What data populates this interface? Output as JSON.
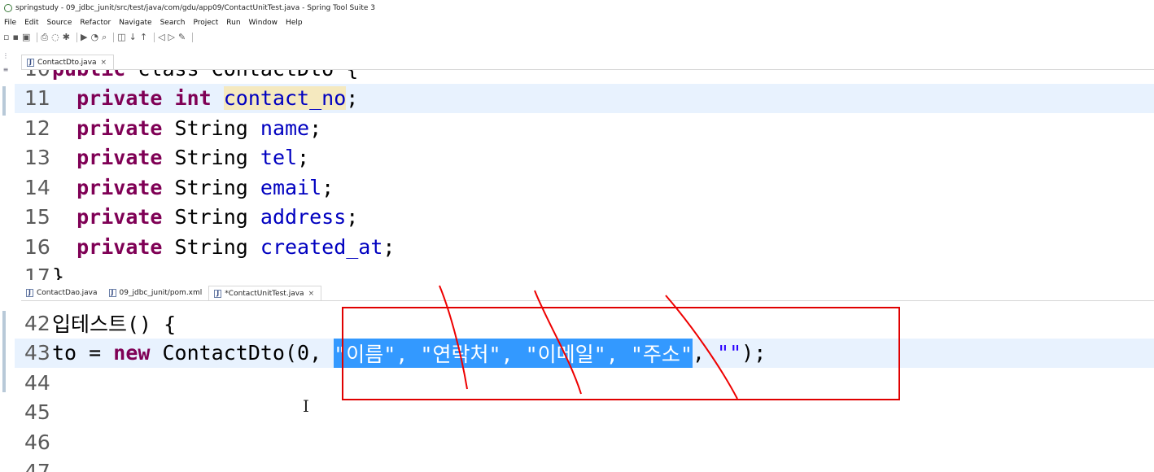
{
  "window": {
    "title": "springstudy - 09_jdbc_junit/src/test/java/com/gdu/app09/ContactUnitTest.java - Spring Tool Suite 3"
  },
  "menu": [
    "File",
    "Edit",
    "Source",
    "Refactor",
    "Navigate",
    "Search",
    "Project",
    "Run",
    "Window",
    "Help"
  ],
  "toolbar_icons": [
    "new-icon",
    "save-icon",
    "save-all-icon",
    "print-icon",
    "skip-icon",
    "debug-icon",
    "run-icon",
    "profile-icon",
    "search-icon",
    "open-type-icon",
    "next-annotation-icon",
    "prev-annotation-icon",
    "back-icon",
    "forward-icon",
    "pin-icon"
  ],
  "top_editor": {
    "tabs": [
      {
        "label": "ContactDto.java",
        "active": true,
        "closable": true
      }
    ],
    "lines": [
      {
        "num": "10",
        "parts": [
          {
            "t": "public",
            "c": "kw"
          },
          {
            "t": " class ContactDto {",
            "c": ""
          }
        ]
      },
      {
        "num": "11",
        "current": true,
        "parts": [
          {
            "t": "  ",
            "c": ""
          },
          {
            "t": "private",
            "c": "kw"
          },
          {
            "t": " ",
            "c": ""
          },
          {
            "t": "int",
            "c": "kw"
          },
          {
            "t": " ",
            "c": ""
          },
          {
            "t": "contact_no",
            "c": "fld occ"
          },
          {
            "t": ";",
            "c": ""
          }
        ]
      },
      {
        "num": "12",
        "parts": [
          {
            "t": "  ",
            "c": ""
          },
          {
            "t": "private",
            "c": "kw"
          },
          {
            "t": " String ",
            "c": ""
          },
          {
            "t": "name",
            "c": "fld"
          },
          {
            "t": ";",
            "c": ""
          }
        ]
      },
      {
        "num": "13",
        "parts": [
          {
            "t": "  ",
            "c": ""
          },
          {
            "t": "private",
            "c": "kw"
          },
          {
            "t": " String ",
            "c": ""
          },
          {
            "t": "tel",
            "c": "fld"
          },
          {
            "t": ";",
            "c": ""
          }
        ]
      },
      {
        "num": "14",
        "parts": [
          {
            "t": "  ",
            "c": ""
          },
          {
            "t": "private",
            "c": "kw"
          },
          {
            "t": " String ",
            "c": ""
          },
          {
            "t": "email",
            "c": "fld"
          },
          {
            "t": ";",
            "c": ""
          }
        ]
      },
      {
        "num": "15",
        "parts": [
          {
            "t": "  ",
            "c": ""
          },
          {
            "t": "private",
            "c": "kw"
          },
          {
            "t": " String ",
            "c": ""
          },
          {
            "t": "address",
            "c": "fld"
          },
          {
            "t": ";",
            "c": ""
          }
        ]
      },
      {
        "num": "16",
        "parts": [
          {
            "t": "  ",
            "c": ""
          },
          {
            "t": "private",
            "c": "kw"
          },
          {
            "t": " String ",
            "c": ""
          },
          {
            "t": "created_at",
            "c": "fld"
          },
          {
            "t": ";",
            "c": ""
          }
        ]
      },
      {
        "num": "17",
        "parts": [
          {
            "t": "}",
            "c": ""
          }
        ]
      }
    ]
  },
  "bottom_editor": {
    "tabs": [
      {
        "label": "ContactDao.java",
        "active": false,
        "closable": false
      },
      {
        "label": "09_jdbc_junit/pom.xml",
        "active": false,
        "closable": false
      },
      {
        "label": "*ContactUnitTest.java",
        "active": true,
        "closable": true
      }
    ],
    "lines": [
      {
        "num": "42",
        "parts": [
          {
            "t": "입테스트() {",
            "c": ""
          }
        ]
      },
      {
        "num": "43",
        "current": true,
        "parts": [
          {
            "t": "to = ",
            "c": ""
          },
          {
            "t": "new",
            "c": "kw"
          },
          {
            "t": " ContactDto(0, ",
            "c": ""
          },
          {
            "t": "\"이름\", \"연락처\", \"이메일\", \"주소\"",
            "c": "sel"
          },
          {
            "t": ", ",
            "c": ""
          },
          {
            "t": "\"\"",
            "c": "str"
          },
          {
            "t": ");",
            "c": ""
          }
        ]
      },
      {
        "num": "44",
        "parts": []
      },
      {
        "num": "45",
        "parts": []
      },
      {
        "num": "46",
        "parts": []
      },
      {
        "num": "47",
        "parts": []
      }
    ]
  },
  "annotation_color": "#e00000",
  "selection_color": "#3399ff"
}
